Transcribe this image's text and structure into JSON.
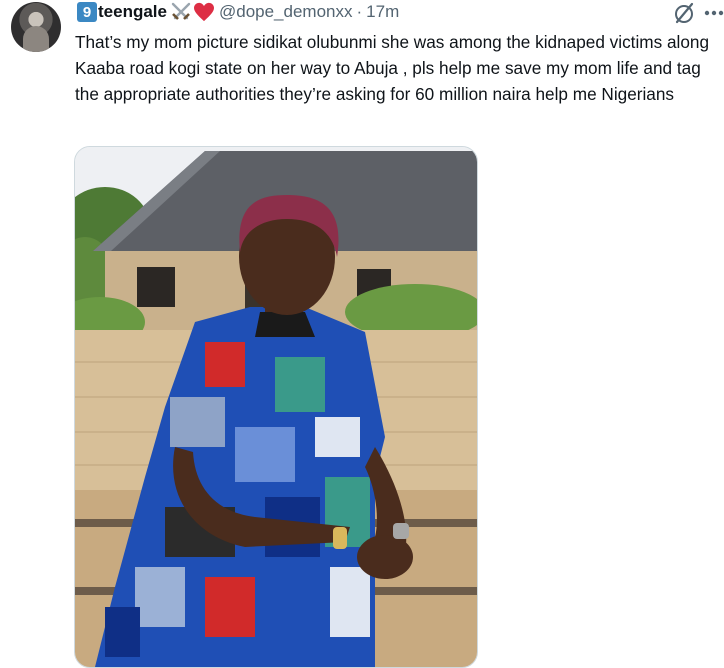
{
  "tweet": {
    "author": {
      "badge_number": "9",
      "display_name": "teengale",
      "emoji_icons": [
        "crossed-swords-icon",
        "red-heart-icon"
      ],
      "handle": "@dope_demonxx",
      "separator": "·",
      "time": "17m"
    },
    "text": "That’s my mom picture sidikat olubunmi she was among the kidnaped victims along Kaaba road kogi state on her way to Abuja , pls help me save my mom life and tag the appropriate authorities they’re asking for 60 million naira help me Nigerians",
    "actions": {
      "grok_icon": "grok-slash-circle-icon",
      "more_icon": "more-dots-icon"
    },
    "media": {
      "kind": "photo",
      "colors": {
        "roof": "#5d6066",
        "wall": "#c9b18c",
        "sky": "#eef0f3",
        "dress_blue": "#1f4fb5",
        "dress_red": "#d12a2a",
        "skin": "#4a2c1d"
      }
    }
  }
}
